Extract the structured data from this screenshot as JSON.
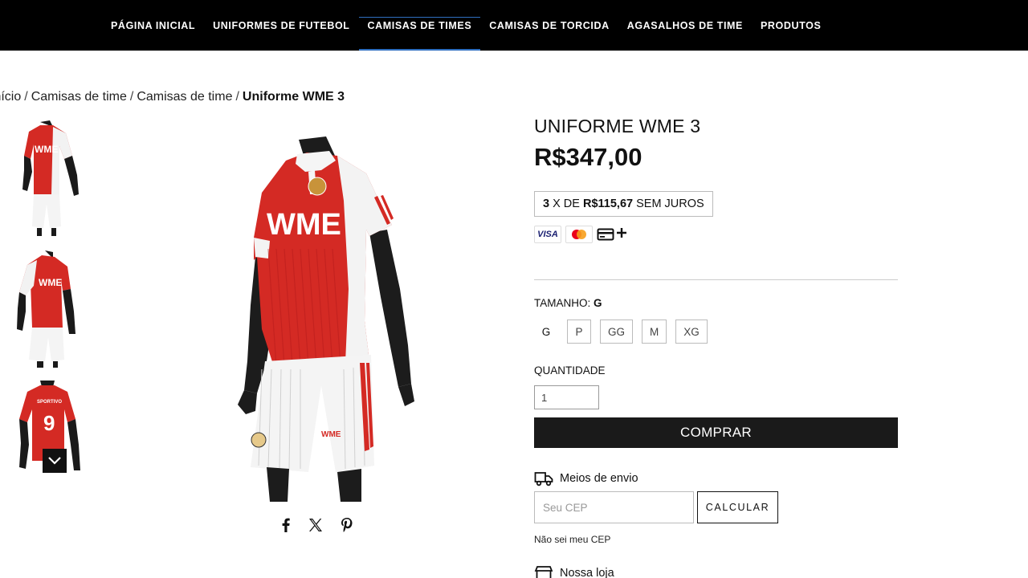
{
  "nav": {
    "items": [
      {
        "label": "PÁGINA INICIAL"
      },
      {
        "label": "UNIFORMES DE FUTEBOL"
      },
      {
        "label": "CAMISAS DE TIMES",
        "active": true
      },
      {
        "label": "CAMISAS DE TORCIDA"
      },
      {
        "label": "AGASALHOS DE TIME"
      },
      {
        "label": "PRODUTOS"
      }
    ]
  },
  "breadcrumb": {
    "items": [
      "Início",
      "Camisas de time",
      "Camisas de time"
    ],
    "separator": "/",
    "current": "Uniforme WME 3"
  },
  "gallery": {
    "thumbnails": [
      {
        "icon": "kit-front-thumbnail",
        "logo_text": "WME"
      },
      {
        "icon": "kit-side-thumbnail",
        "logo_text": "WME"
      },
      {
        "icon": "kit-back-thumbnail",
        "number": "9",
        "name_text": "SPORTIVO"
      }
    ],
    "scroll_icon": "chevron-down-icon",
    "main_logo_text": "WME",
    "main_short_text": "WME"
  },
  "share": {
    "icons": [
      "facebook-icon",
      "x-icon",
      "pinterest-icon"
    ]
  },
  "product": {
    "title": "UNIFORME WME 3",
    "price": "R$347,00",
    "installments": {
      "count": "3",
      "mid": " X DE ",
      "amount": "R$115,67",
      "suffix": " SEM JUROS"
    },
    "payment_icons": {
      "visa_text": "VISA",
      "mastercard_icon": "mastercard-icon",
      "card_icon": "credit-card-icon",
      "more_icon": "plus-icon"
    },
    "size": {
      "label": "TAMANHO: ",
      "selected": "G",
      "options": [
        "G",
        "P",
        "GG",
        "M",
        "XG"
      ]
    },
    "quantity": {
      "label": "QUANTIDADE",
      "value": "1"
    },
    "buy_label": "COMPRAR"
  },
  "shipping": {
    "title": "Meios de envio",
    "icon": "truck-icon",
    "cep_placeholder": "Seu CEP",
    "calc_label": "CALCULAR",
    "no_cep_link": "Não sei meu CEP"
  },
  "store": {
    "title": "Nossa loja",
    "icon": "store-icon"
  },
  "colors": {
    "nav_bg": "#000000",
    "accent_blue": "#2f6fc0",
    "kit_red": "#d42a24",
    "button_bg": "#1a1a1a"
  }
}
